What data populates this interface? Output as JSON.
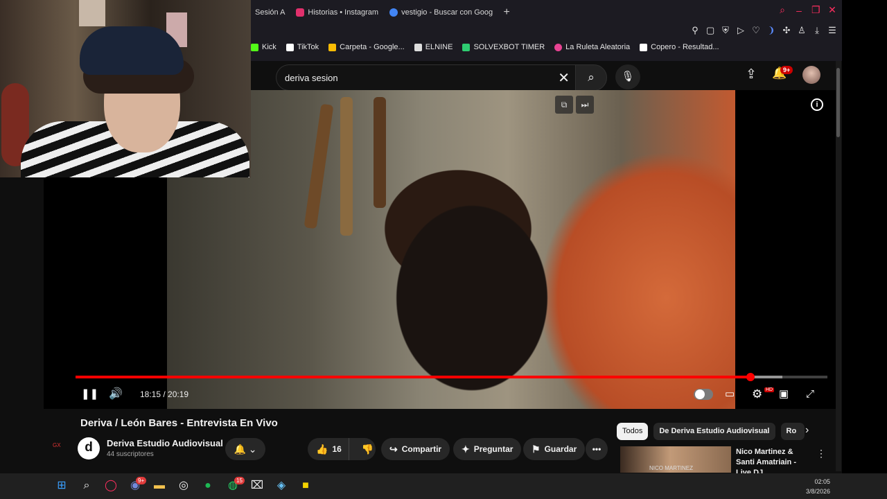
{
  "browser": {
    "tabs": [
      {
        "label": "Sesión A",
        "icon": "session-icon",
        "color": "#444444"
      },
      {
        "label": "Historias • Instagram",
        "icon": "instagram-icon",
        "color": "#e1306c"
      },
      {
        "label": "vestigio - Buscar con Goog",
        "icon": "google-icon",
        "color": "#4285f4"
      }
    ],
    "new_tab": "+",
    "window_controls": [
      "search-icon",
      "minimize-icon",
      "restore-icon",
      "close-icon"
    ],
    "toolbar_icons": [
      "pin-icon",
      "snapshot-icon",
      "shield-icon",
      "play-icon",
      "heart-icon",
      "extension-icon",
      "puzzle-icon",
      "wallet-icon",
      "download-icon",
      "menu-icon"
    ],
    "bookmarks": [
      {
        "label": "Kick",
        "color": "#53fc18"
      },
      {
        "label": "TikTok",
        "color": "#ffffff"
      },
      {
        "label": "Carpeta - Google...",
        "color": "#fbbc04"
      },
      {
        "label": "ELNINE",
        "color": "#dddddd"
      },
      {
        "label": "SOLVEXBOT TIMER",
        "color": "#2ecc71"
      },
      {
        "label": "La Ruleta Aleatoria",
        "color": "#e84393"
      },
      {
        "label": "Copero - Resultad...",
        "color": "#ffffff"
      }
    ]
  },
  "youtube": {
    "search_query": "deriva sesion",
    "notification_badge": "9+",
    "player": {
      "time_current": "18:15",
      "time_total": "20:19",
      "time_display": "18:15 / 20:19",
      "progress_played": 0.898,
      "progress_loaded": 0.94
    },
    "video_title": "Deriva / León Bares - Entrevista En Vivo",
    "channel_initial": "d",
    "channel_name": "Deriva Estudio Audiovisual",
    "subscribers": "44 suscriptores",
    "likes": "16",
    "share_label": "Compartir",
    "ask_label": "Preguntar",
    "save_label": "Guardar",
    "chips": [
      "Todos",
      "De Deriva Estudio Audiovisual",
      "Ro"
    ],
    "recommendation": {
      "title": "Nico Martinez & Santi Amatriain - Live DJ ...",
      "thumb_caption": "NICO MARTINEZ"
    },
    "sidebar_label": "GX"
  },
  "taskbar": {
    "clock_time": "02:05",
    "clock_date": "3/8/2026",
    "discord_badge": "9+",
    "whatsapp_badge": "15"
  }
}
